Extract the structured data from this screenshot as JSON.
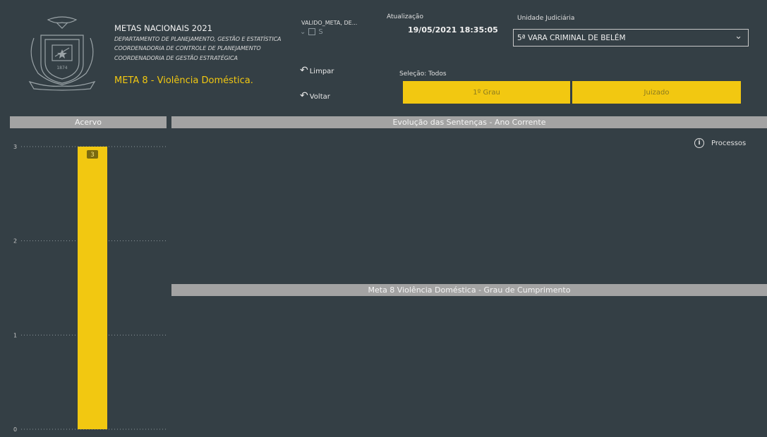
{
  "header": {
    "title": "METAS NACIONAIS 2021",
    "lines": [
      "DEPARTAMENTO DE PLANEJAMENTO, GESTÃO E ESTATÍSTICA",
      "COORDENADORIA DE CONTROLE DE PLANEJAMENTO",
      "COORDENADORIA DE GESTÃO ESTRATÉGICA"
    ],
    "meta_title": "META 8 - Violência Doméstica.",
    "crest_year": "1874"
  },
  "filter": {
    "label": "VALIDO_META, DE...",
    "option": "S"
  },
  "buttons": {
    "limpar": "Limpar",
    "voltar": "Voltar"
  },
  "update": {
    "label": "Atualização",
    "value": "19/05/2021 18:35:05"
  },
  "unit": {
    "label": "Unidade Judiciária",
    "selected": "5ª VARA CRIMINAL DE BELÉM"
  },
  "selection": {
    "label": "Seleção: Todos",
    "options": [
      "1º Grau",
      "Juizado"
    ]
  },
  "sections": {
    "acervo": "Acervo",
    "evolucao": "Evolução das Sentenças - Ano Corrente",
    "grau": "Meta 8 Violência Doméstica - Grau de Cumprimento"
  },
  "info": {
    "label": "Processos"
  },
  "colors": {
    "background": "#343f45",
    "accent": "#f2c811",
    "section_header": "#a3a3a3"
  },
  "chart_data": {
    "type": "bar",
    "categories": [
      ""
    ],
    "values": [
      3
    ],
    "data_labels": [
      "3"
    ],
    "yticks": [
      "0",
      "1",
      "2",
      "3"
    ],
    "ylim": [
      0,
      3
    ],
    "grid": true,
    "color": "#f2c811"
  }
}
